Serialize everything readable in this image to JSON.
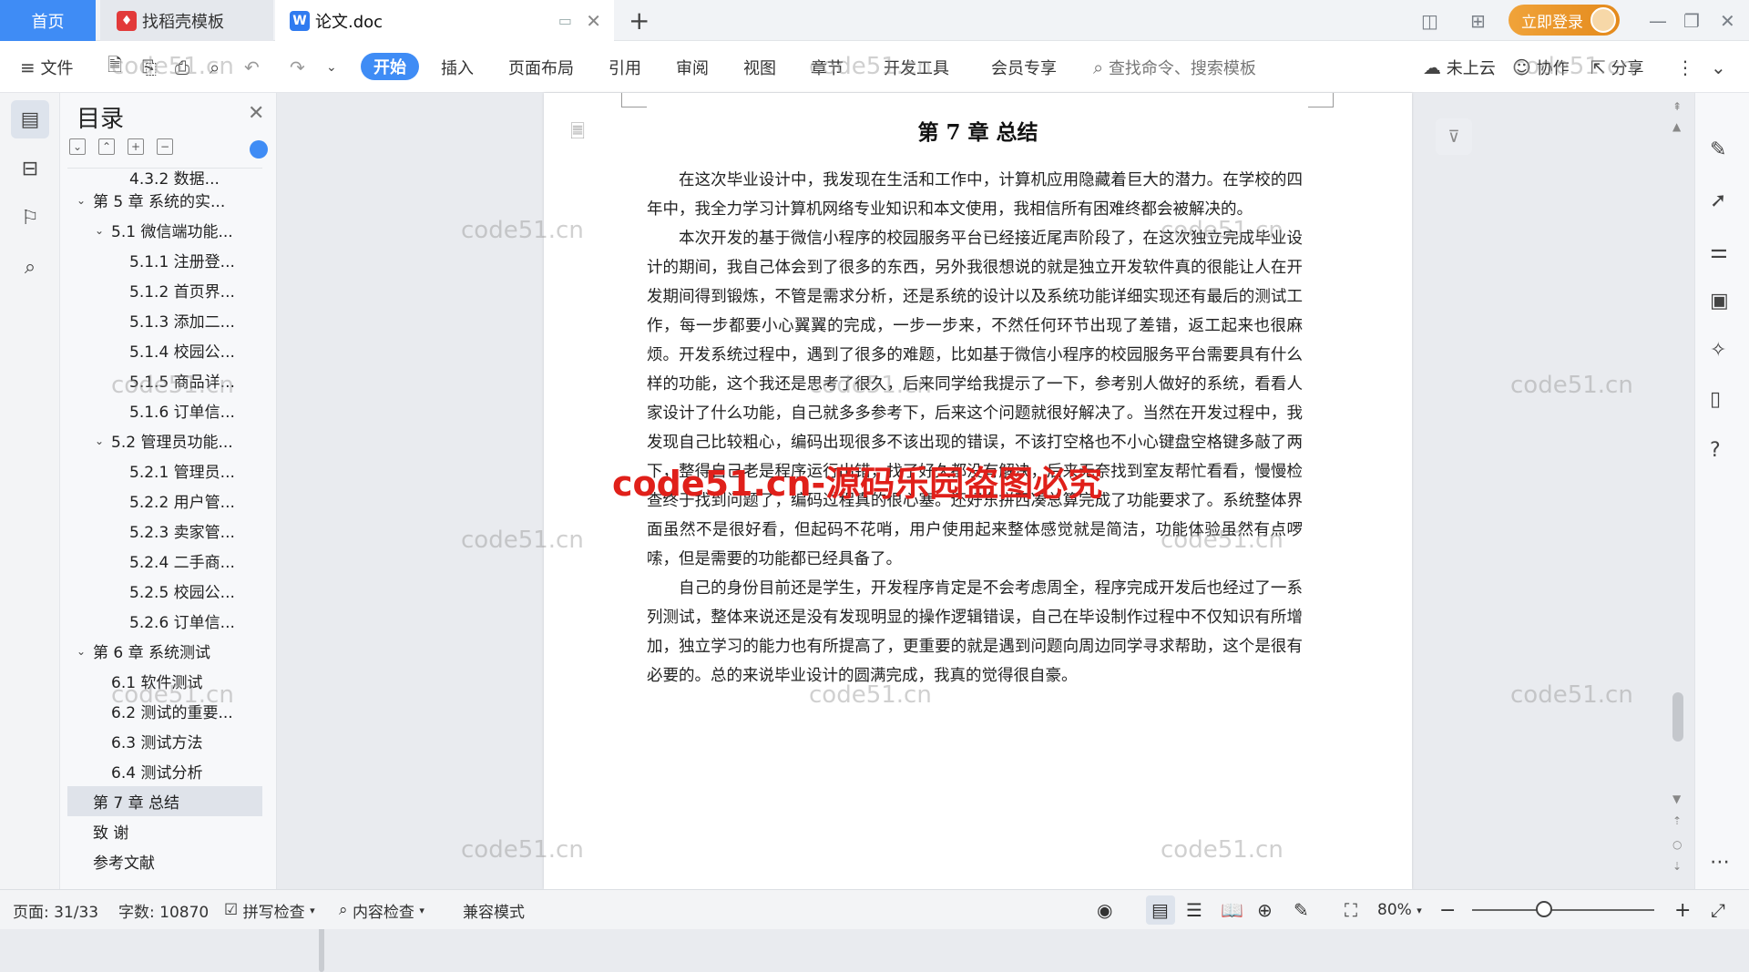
{
  "tabs": {
    "home": "首页",
    "template": "找稻壳模板",
    "doc": "论文.doc"
  },
  "window": {
    "login": "立即登录"
  },
  "toolbar": {
    "file": "文件",
    "menus": [
      "开始",
      "插入",
      "页面布局",
      "引用",
      "审阅",
      "视图",
      "章节",
      "开发工具",
      "会员专享"
    ],
    "search_placeholder": "查找命令、搜索模板",
    "cloud": "未上云",
    "collab": "协作",
    "share": "分享"
  },
  "toc": {
    "title": "目录",
    "items": [
      {
        "label": "4.3.2 数据...",
        "level": 3,
        "arrow": ""
      },
      {
        "label": "第 5 章  系统的实...",
        "level": 1,
        "arrow": "v"
      },
      {
        "label": "5.1 微信端功能...",
        "level": 2,
        "arrow": "v"
      },
      {
        "label": "5.1.1 注册登...",
        "level": 3,
        "arrow": ""
      },
      {
        "label": "5.1.2 首页界...",
        "level": 3,
        "arrow": ""
      },
      {
        "label": "5.1.3 添加二...",
        "level": 3,
        "arrow": ""
      },
      {
        "label": "5.1.4 校园公...",
        "level": 3,
        "arrow": ""
      },
      {
        "label": "5.1.5 商品详...",
        "level": 3,
        "arrow": ""
      },
      {
        "label": "5.1.6 订单信...",
        "level": 3,
        "arrow": ""
      },
      {
        "label": "5.2 管理员功能...",
        "level": 2,
        "arrow": "v"
      },
      {
        "label": "5.2.1 管理员...",
        "level": 3,
        "arrow": ""
      },
      {
        "label": "5.2.2 用户管...",
        "level": 3,
        "arrow": ""
      },
      {
        "label": "5.2.3 卖家管...",
        "level": 3,
        "arrow": ""
      },
      {
        "label": "5.2.4 二手商...",
        "level": 3,
        "arrow": ""
      },
      {
        "label": "5.2.5 校园公...",
        "level": 3,
        "arrow": ""
      },
      {
        "label": "5.2.6 订单信...",
        "level": 3,
        "arrow": ""
      },
      {
        "label": "第 6 章  系统测试",
        "level": 1,
        "arrow": "v"
      },
      {
        "label": "6.1 软件测试",
        "level": 2,
        "arrow": ""
      },
      {
        "label": "6.2 测试的重要...",
        "level": 2,
        "arrow": ""
      },
      {
        "label": "6.3 测试方法",
        "level": 2,
        "arrow": ""
      },
      {
        "label": "6.4 测试分析",
        "level": 2,
        "arrow": ""
      },
      {
        "label": "第 7 章  总结",
        "level": 1,
        "arrow": "",
        "selected": true
      },
      {
        "label": "致    谢",
        "level": 1,
        "arrow": ""
      },
      {
        "label": "参考文献",
        "level": 1,
        "arrow": ""
      }
    ]
  },
  "document": {
    "chapter_title": "第 7 章  总结",
    "paragraphs": [
      "在这次毕业设计中，我发现在生活和工作中，计算机应用隐藏着巨大的潜力。在学校的四年中，我全力学习计算机网络专业知识和本文使用，我相信所有困难终都会被解决的。",
      "本次开发的基于微信小程序的校园服务平台已经接近尾声阶段了，在这次独立完成毕业设计的期间，我自己体会到了很多的东西，另外我很想说的就是独立开发软件真的很能让人在开发期间得到锻炼，不管是需求分析，还是系统的设计以及系统功能详细实现还有最后的测试工作，每一步都要小心翼翼的完成，一步一步来，不然任何环节出现了差错，返工起来也很麻烦。开发系统过程中，遇到了很多的难题，比如基于微信小程序的校园服务平台需要具有什么样的功能，这个我还是思考了很久，后来同学给我提示了一下，参考别人做好的系统，看看人家设计了什么功能，自己就多多参考下，后来这个问题就很好解决了。当然在开发过程中，我发现自己比较粗心，编码出现很多不该出现的错误，不该打空格也不小心键盘空格键多敲了两下，整得自己老是程序运行出错，找了好久都没有解决，后来无奈找到室友帮忙看看，慢慢检查终于找到问题了，编码过程真的很心塞。还好东拼西凑总算完成了功能要求了。系统整体界面虽然不是很好看，但起码不花哨，用户使用起来整体感觉就是简洁，功能体验虽然有点啰嗦，但是需要的功能都已经具备了。",
      "自己的身份目前还是学生，开发程序肯定是不会考虑周全，程序完成开发后也经过了一系列测试，整体来说还是没有发现明显的操作逻辑错误，自己在毕设制作过程中不仅知识有所增加，独立学习的能力也有所提高了，更重要的就是遇到问题向周边同学寻求帮助，这个是很有必要的。总的来说毕业设计的圆满完成，我真的觉得很自豪。"
    ]
  },
  "watermarks": {
    "gray": "code51.cn",
    "red": "code51.cn-源码乐园盗图必究"
  },
  "status": {
    "page": "页面: 31/33",
    "words": "字数: 10870",
    "spell": "拼写检查",
    "content_check": "内容检查",
    "compat": "兼容模式",
    "zoom": "80%"
  }
}
